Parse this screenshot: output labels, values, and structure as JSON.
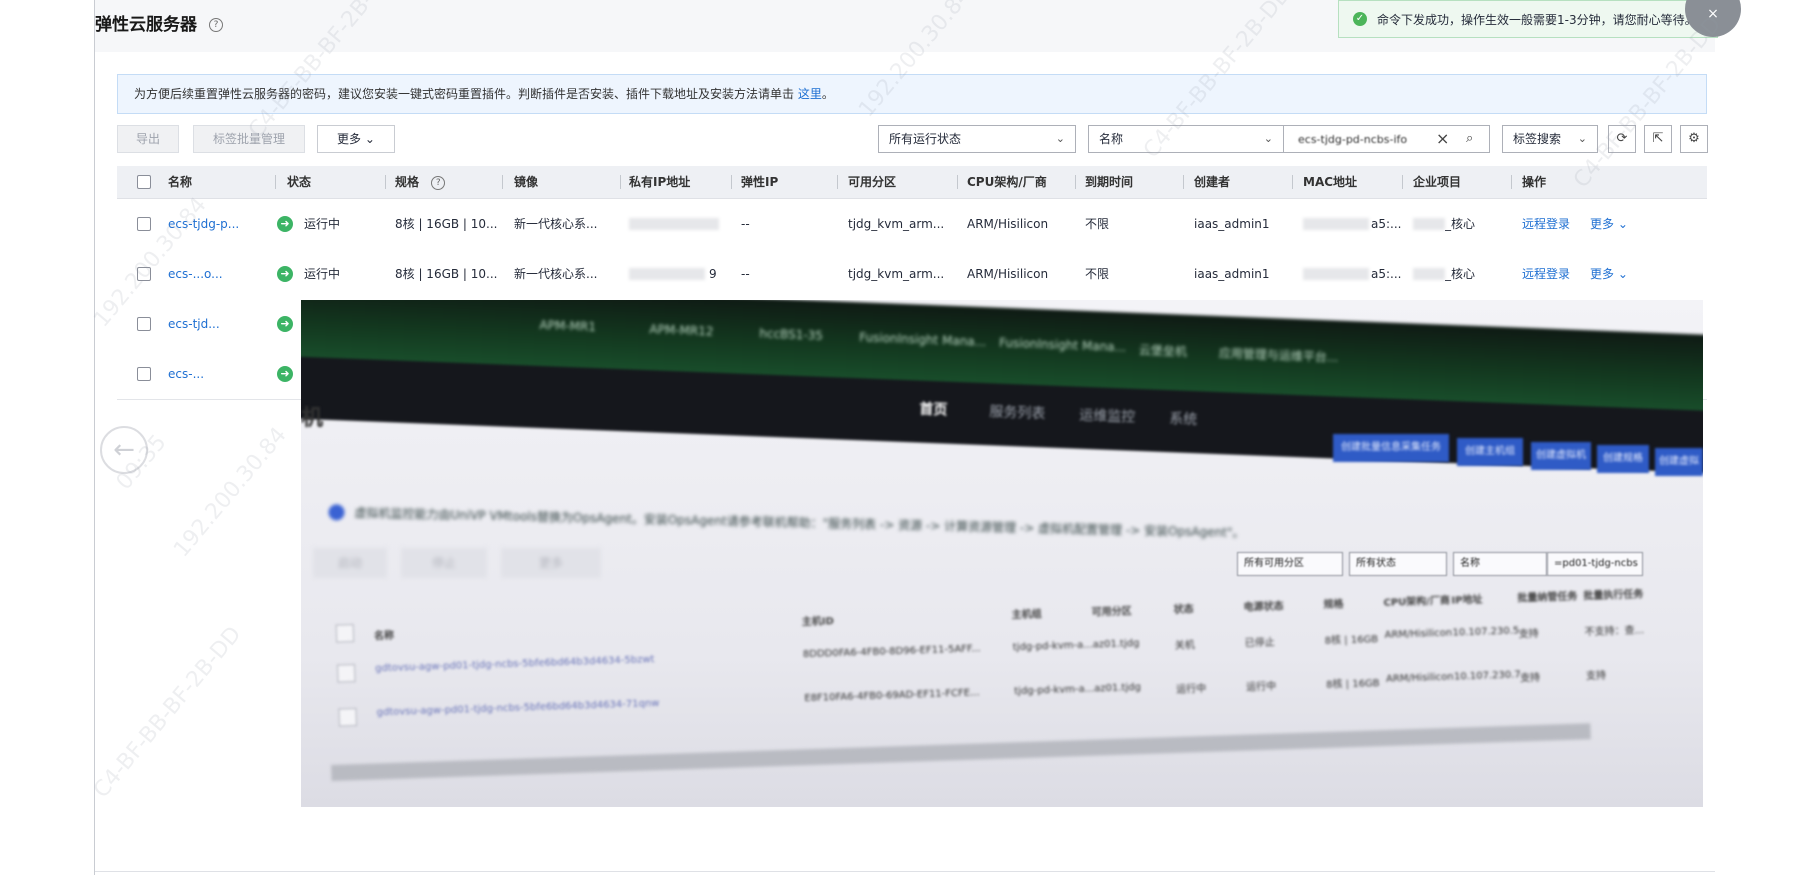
{
  "page": {
    "title": "弹性云服务器",
    "help_icon": "?"
  },
  "toast": {
    "message": "命令下发成功，操作生效一般需要1-3分钟，请您耐心等待。",
    "close_icon": "×"
  },
  "info_bar": {
    "text": "为方便后续重置弹性云服务器的密码，建议您安装一键式密码重置插件。判断插件是否安装、插件下载地址及安装方法请单击",
    "link": "这里",
    "suffix": "。"
  },
  "toolbar": {
    "export_label": "导出",
    "tag_batch_label": "标签批量管理",
    "more_label": "更多",
    "status_filter": "所有运行状态",
    "search_field": "名称",
    "search_value": "ecs-tjdg-pd-ncbs-ifo",
    "tag_search_label": "标签搜索"
  },
  "table": {
    "columns": [
      "名称",
      "状态",
      "规格",
      "镜像",
      "私有IP地址",
      "弹性IP",
      "可用分区",
      "CPU架构/厂商",
      "到期时间",
      "创建者",
      "MAC地址",
      "企业项目",
      "操作"
    ],
    "rows": [
      {
        "name": "ecs-tjdg-p...",
        "status": "运行中",
        "spec": "8核 | 16GB | 10...",
        "image": "新一代核心系...",
        "private_ip": "",
        "eip": "--",
        "az": "tjdg_kvm_arm...",
        "cpu": "ARM/Hisilicon",
        "expire": "不限",
        "creator": "iaas_admin1",
        "mac": "a5:...",
        "project": "_核心",
        "action1": "远程登录",
        "action2": "更多"
      },
      {
        "name": "ecs-...o...",
        "status": "运行中",
        "spec": "8核 | 16GB | 10...",
        "image": "新一代核心系...",
        "private_ip": "9",
        "eip": "--",
        "az": "tjdg_kvm_arm...",
        "cpu": "ARM/Hisilicon",
        "expire": "不限",
        "creator": "iaas_admin1",
        "mac": "a5:...",
        "project": "_核心",
        "action1": "远程登录",
        "action2": "更多"
      },
      {
        "name": "ecs-tjd..."
      },
      {
        "name": "ecs-..."
      }
    ]
  },
  "watermark": {
    "time": "09:35",
    "ip": "192.200.30.84",
    "id": "C4-BF-BB-BF-2B-DD"
  },
  "photo": {
    "browser_tabs": [
      "APM-MR1",
      "APM-MR12",
      "hccBS1-35",
      "FusionInsight Mana...",
      "FusionInsight Mana...",
      "云堡垒机",
      "应用管理与运维平台..."
    ],
    "nav_items": [
      "首页",
      "服务列表",
      "运维监控",
      "系统"
    ],
    "page_title": "机",
    "action_buttons": [
      "创建批量信息采集任务",
      "创建主机组",
      "创建虚拟机",
      "创建规格",
      "创建虚拟"
    ],
    "note": "虚拟机监控能力由UniVP VMtools替换为OpsAgent。安装OpsAgent请参考联机帮助：\"服务列表 -> 资源 -> 计算资源管理 -> 虚拟机配置管理 -> 安装OpsAgent\"。",
    "grey_buttons": [
      "启动",
      "停止",
      "更多"
    ],
    "filters": [
      "所有可用分区",
      "所有状态",
      "名称"
    ],
    "filter_value": "=pd01-tjdg-ncbs",
    "columns": [
      "名称",
      "主机ID",
      "主机组",
      "可用分区",
      "状态",
      "电源状态",
      "规格",
      "CPU架构/厂商",
      "IP地址",
      "批量纳管任务",
      "批量执行任务"
    ],
    "rows": [
      {
        "name": "gdtovsu-agw-pd01-tjdg-ncbs-5bfe6bd64b3d4634-5bzwt",
        "id": "8DDD0FA6-4FB0-8D96-EF11-5AFF...",
        "group": "tjdg-pd-kvm-a...",
        "az": "az01.tjdg",
        "state": "关机",
        "power": "已停止",
        "spec": "8核 | 16GB",
        "cpu": "ARM/Hisilicon",
        "ip": "10.107.230.5...",
        "task1": "支持",
        "task2": "不支持：查..."
      },
      {
        "name": "gdtovsu-agw-pd01-tjdg-ncbs-5bfe6bd64b3d4634-71qnw",
        "id": "E8F10FA6-4FB0-69AD-EF11-FCFE...",
        "group": "tjdg-pd-kvm-a...",
        "az": "az01.tjdg",
        "state": "运行中",
        "power": "运行中",
        "spec": "8核 | 16GB",
        "cpu": "ARM/Hisilicon",
        "ip": "10.107.230.7...",
        "task1": "支持",
        "task2": "支持"
      }
    ]
  }
}
